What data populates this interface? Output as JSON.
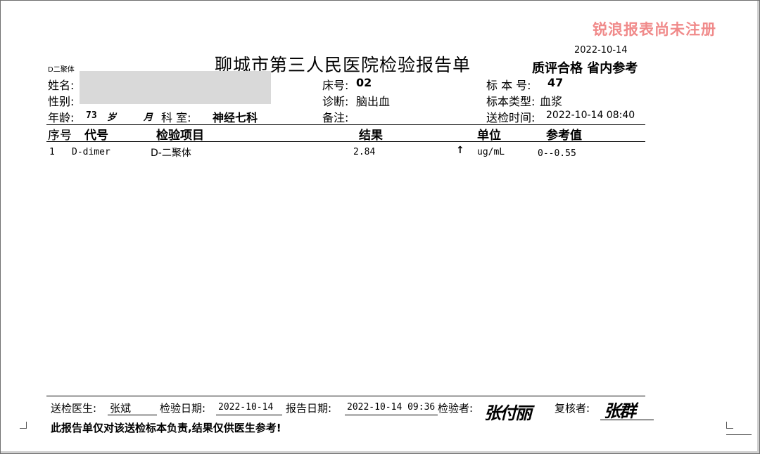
{
  "watermark": "锐浪报表尚未注册",
  "report": {
    "date": "2022-10-14",
    "title": "聊城市第三人民医院检验报告单",
    "quality_note": "质评合格  省内参考",
    "item_code_label": "D二聚体"
  },
  "patient": {
    "name_label": "姓名:",
    "sex_label": "性别:",
    "age_label": "年龄:",
    "age_value": "73",
    "age_unit": "岁",
    "month_unit": "月",
    "dept_label": "科  室:",
    "dept_value": "神经七科",
    "bed_label": "床号:",
    "bed_value": "02",
    "diagnosis_label": "诊断:",
    "diagnosis_value": "脑出血",
    "remark_label": "备注:",
    "specimen_no_label": "标 本 号:",
    "specimen_no_value": "47",
    "specimen_type_label": "标本类型:",
    "specimen_type_value": "血浆",
    "submit_time_label": "送检时间:",
    "submit_time_value": "2022-10-14 08:40"
  },
  "table": {
    "headers": [
      "序号",
      "代号",
      "检验项目",
      "结果",
      "单位",
      "参考值"
    ],
    "rows": [
      {
        "no": "1",
        "code": "D-dimer",
        "item": "D-二聚体",
        "result": "2.84",
        "flag": "↑",
        "unit": "ug/mL",
        "ref": "0--0.55"
      }
    ]
  },
  "footer": {
    "doctor_label": "送检医生:",
    "doctor_value": "张斌",
    "test_date_label": "检验日期:",
    "test_date_value": "2022-10-14",
    "report_date_label": "报告日期:",
    "report_date_value": "2022-10-14 09:36",
    "tester_label": "检验者:",
    "tester_signature": "张付丽",
    "reviewer_label": "复核者:",
    "reviewer_signature": "张群",
    "disclaimer": "此报告单仅对该送检标本负责,结果仅供医生参考!"
  }
}
